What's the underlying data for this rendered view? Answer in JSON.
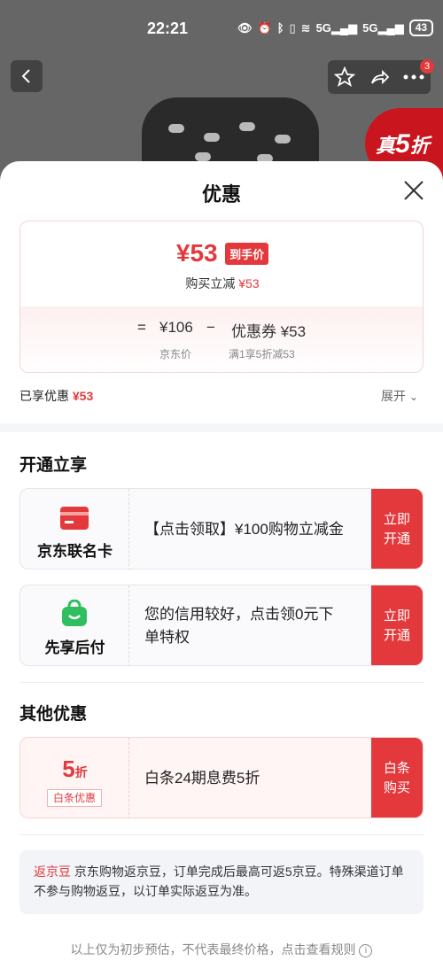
{
  "status_bar": {
    "time": "22:21",
    "network": "5G",
    "battery": "43"
  },
  "background": {
    "cart_badge": "3",
    "promo_prefix": "真",
    "promo_number": "5",
    "promo_suffix": "折"
  },
  "sheet": {
    "title": "优惠",
    "price": {
      "final_price": "¥53",
      "final_tag": "到手价",
      "instant_discount_label": "购买立减",
      "instant_discount_value": "¥53",
      "eq_sign": "=",
      "original_price": "¥106",
      "minus_sign": "−",
      "coupon_label": "优惠券 ¥53",
      "original_caption": "京东价",
      "coupon_caption": "满1享5折减53"
    },
    "enjoyed_label": "已享优惠",
    "enjoyed_value": "¥53",
    "expand_label": "展开",
    "section_open": {
      "title": "开通立享",
      "cards": [
        {
          "label": "京东联名卡",
          "text": "【点击领取】¥100购物立减金",
          "button": "立即开通"
        },
        {
          "label": "先享后付",
          "text": "您的信用较好，点击领0元下单特权",
          "button": "立即开通"
        }
      ]
    },
    "section_other": {
      "title": "其他优惠",
      "card": {
        "discount_number": "5",
        "discount_unit": "折",
        "tag": "白条优惠",
        "text": "白条24期息费5折",
        "button": "白条购买"
      }
    },
    "jd_bean": {
      "label": "返京豆",
      "text": "京东购物返京豆，订单完成后最高可返5京豆。特殊渠道订单不参与购物返豆，以订单实际返豆为准。"
    },
    "footer": "以上仅为初步预估，不代表最终价格，点击查看规则"
  },
  "colors": {
    "accent": "#e4393c",
    "green": "#2fbf5f"
  }
}
